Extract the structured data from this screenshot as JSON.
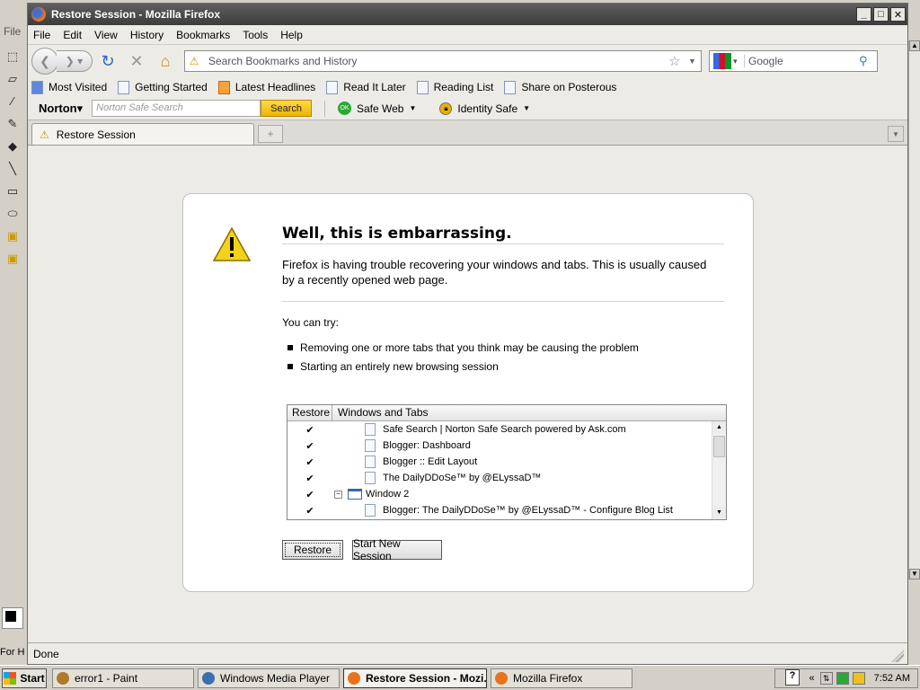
{
  "paint": {
    "menu_file": "File",
    "status_text": "For H"
  },
  "window": {
    "title": "Restore Session - Mozilla Firefox"
  },
  "menubar": [
    "File",
    "Edit",
    "View",
    "History",
    "Bookmarks",
    "Tools",
    "Help"
  ],
  "navbar": {
    "url_placeholder": "Search Bookmarks and History",
    "search_placeholder": "Google"
  },
  "bookmarks": [
    {
      "label": "Most Visited",
      "icon": "most-visited-icon"
    },
    {
      "label": "Getting Started",
      "icon": "page-icon"
    },
    {
      "label": "Latest Headlines",
      "icon": "rss-icon"
    },
    {
      "label": "Read It Later",
      "icon": "page-icon"
    },
    {
      "label": "Reading List",
      "icon": "page-icon"
    },
    {
      "label": "Share on Posterous",
      "icon": "page-icon"
    }
  ],
  "norton": {
    "logo": "Norton",
    "search_placeholder": "Norton Safe Search",
    "search_button": "Search",
    "safe_web": "Safe Web",
    "identity_safe": "Identity Safe"
  },
  "tab": {
    "label": "Restore Session"
  },
  "page": {
    "heading": "Well, this is embarrassing.",
    "description": "Firefox is having trouble recovering your windows and tabs. This is usually caused by a recently opened web page.",
    "try_label": "You can try:",
    "bullets": [
      "Removing one or more tabs that you think may be causing the problem",
      "Starting an entirely new browsing session"
    ],
    "tree_headers": {
      "restore": "Restore",
      "tabs": "Windows and Tabs"
    },
    "tree_rows": [
      {
        "checked": "✔",
        "label": "Safe Search | Norton Safe Search powered by Ask.com",
        "type": "tab"
      },
      {
        "checked": "✔",
        "label": "Blogger: Dashboard",
        "type": "tab"
      },
      {
        "checked": "✔",
        "label": "Blogger :: Edit Layout",
        "type": "tab"
      },
      {
        "checked": "✔",
        "label": "The DailyDDoSe™ by @ELyssaD™",
        "type": "tab"
      },
      {
        "checked": "✔",
        "label": "Window 2",
        "type": "window"
      },
      {
        "checked": "✔",
        "label": "Blogger: The DailyDDoSe™ by @ELyssaD™ - Configure Blog List",
        "type": "tab"
      }
    ],
    "restore_button": "Restore",
    "new_session_button": "Start New Session"
  },
  "status": "Done",
  "taskbar": {
    "start": "Start",
    "items": [
      {
        "label": "error1 - Paint",
        "active": false,
        "color": "#b07a2a"
      },
      {
        "label": "Windows Media Player",
        "active": false,
        "color": "#3a6fb0"
      },
      {
        "label": "Restore Session - Mozi...",
        "active": true,
        "color": "#e8731c"
      },
      {
        "label": "Mozilla Firefox",
        "active": false,
        "color": "#e8731c"
      }
    ],
    "clock": "7:52 AM",
    "tray_chevron": "«"
  }
}
